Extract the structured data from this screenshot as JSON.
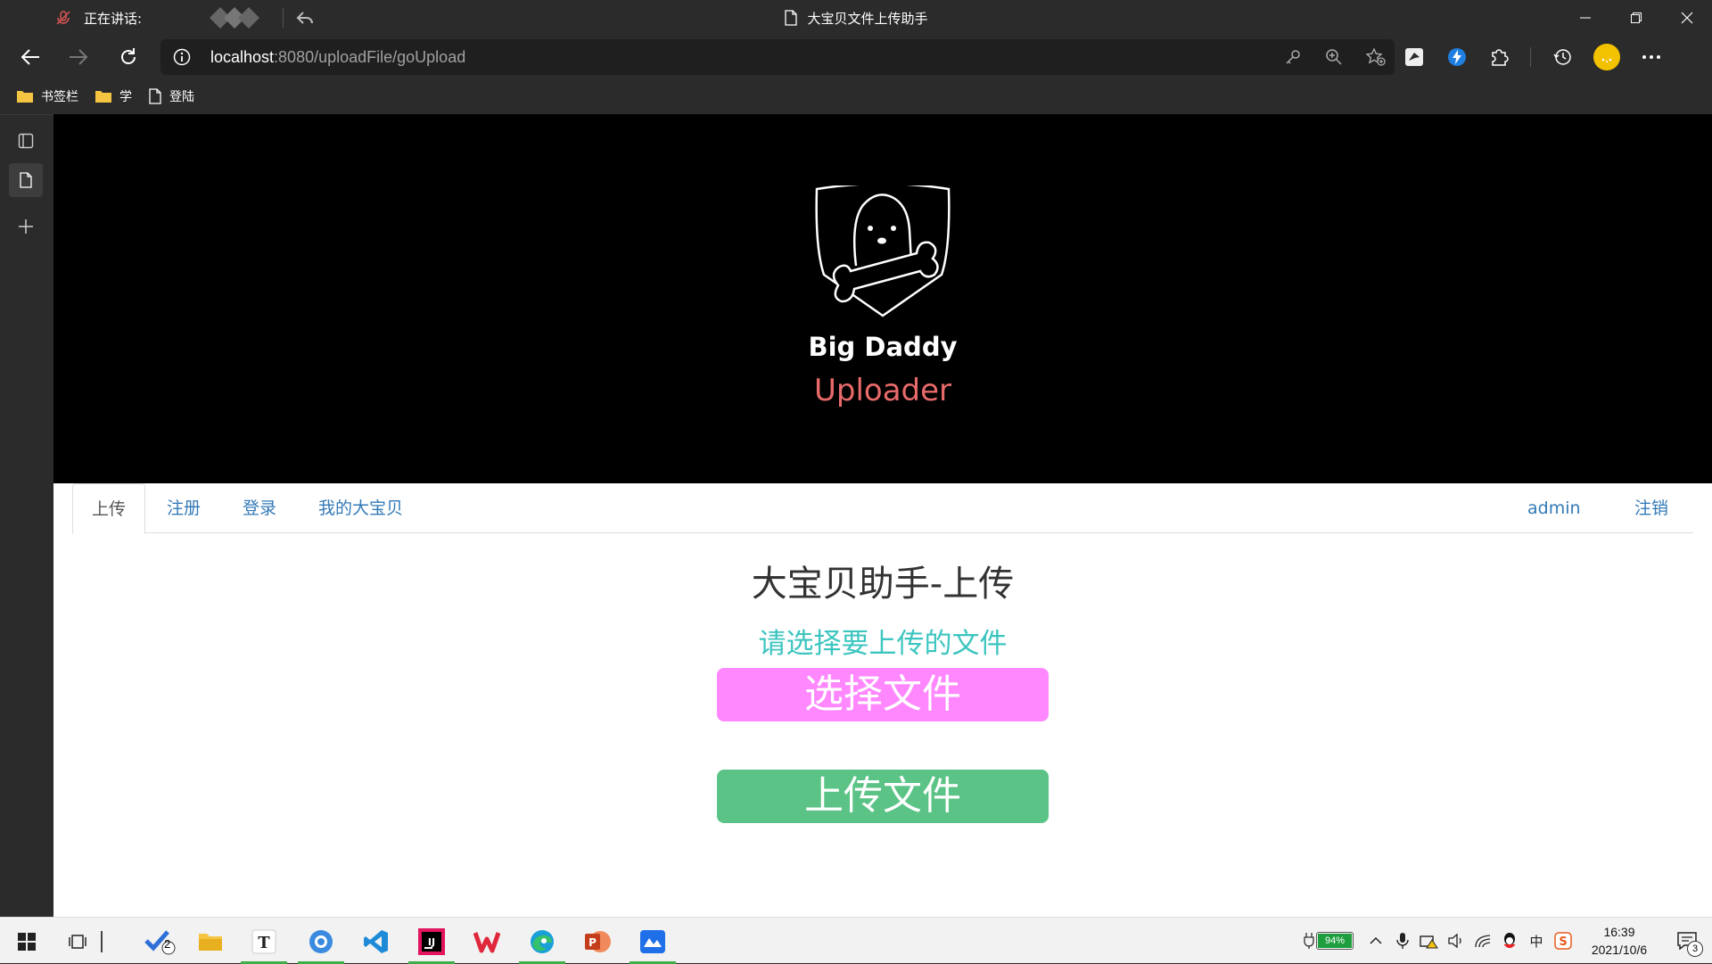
{
  "window": {
    "speaking_label": "正在讲话:",
    "tab_title": "大宝贝文件上传助手"
  },
  "address_bar": {
    "host": "localhost",
    "path": ":8080/uploadFile/goUpload"
  },
  "bookmarks": [
    {
      "label": "书签栏",
      "icon": "folder-icon"
    },
    {
      "label": "学",
      "icon": "folder-icon"
    },
    {
      "label": "登陆",
      "icon": "page-icon"
    }
  ],
  "hero": {
    "brand_line1": "Big Daddy",
    "brand_line2": "Uploader"
  },
  "nav": {
    "tabs": [
      "上传",
      "注册",
      "登录",
      "我的大宝贝"
    ],
    "active_tab": "上传",
    "user": "admin",
    "logout": "注销"
  },
  "main": {
    "heading": "大宝贝助手-上传",
    "prompt": "请选择要上传的文件",
    "choose_button": "选择文件",
    "upload_button": "上传文件"
  },
  "taskbar": {
    "todo_badge": "2",
    "battery_percent": "94%",
    "ime": "中",
    "time": "16:39",
    "date": "2021/10/6",
    "notification_count": "3"
  },
  "colors": {
    "choose_button": "#ff88ff",
    "upload_button": "#5bc386",
    "prompt_text": "#3cc5c0",
    "brand_accent": "#e96a6a",
    "link": "#337ab7"
  }
}
